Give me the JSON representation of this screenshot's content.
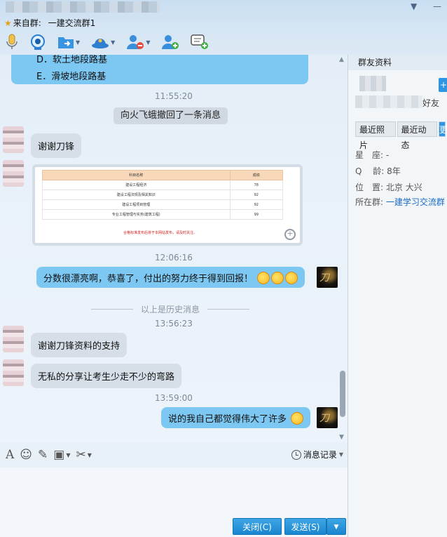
{
  "header": {
    "source_prefix": "来自群:",
    "group_name": "一建交流群1",
    "win_min": "▼",
    "win_close": "—"
  },
  "toolbar": [
    {
      "name": "voice",
      "has_caret": false
    },
    {
      "name": "video",
      "has_caret": false
    },
    {
      "name": "file",
      "has_caret": true
    },
    {
      "name": "app",
      "has_caret": true
    },
    {
      "name": "remove-member",
      "has_caret": false
    },
    {
      "name": "add-member",
      "has_caret": false
    },
    {
      "name": "new-message",
      "has_caret": false
    }
  ],
  "chat": {
    "top_options": [
      "D．软土地段路基",
      "E．滑坡地段路基"
    ],
    "messages": [
      {
        "time": "11:55:20"
      },
      {
        "recall": "向火飞蛾撤回了一条消息"
      },
      {
        "sender": "other",
        "text": "谢谢刀锋"
      },
      {
        "sender": "other",
        "type": "image"
      },
      {
        "time": "12:06:16"
      },
      {
        "sender": "me",
        "text": "分数很漂亮啊，恭喜了，付出的努力终于得到回报！"
      },
      {
        "divider": "以上是历史消息"
      },
      {
        "time": "13:56:23"
      },
      {
        "sender": "other",
        "text": "谢谢刀锋资料的支持"
      },
      {
        "sender": "other",
        "text": "无私的分享让考生少走不少的弯路"
      },
      {
        "time": "13:59:00"
      },
      {
        "sender": "me",
        "text": "说的我自己都觉得伟大了许多"
      }
    ],
    "score_table": {
      "headers": [
        "科目名称",
        "成绩"
      ],
      "rows": [
        [
          "建设工程经济",
          "78"
        ],
        [
          "建设工程法规及相关知识",
          "92"
        ],
        [
          "建设工程项目管理",
          "92"
        ],
        [
          "专业工程管理与实务(建筑工程)",
          "99"
        ]
      ],
      "note": "合格标准发布后将于本网站发布，请及时关注。"
    },
    "my_avatar_glyph": "刀"
  },
  "input_toolbar": {
    "history_label": "消息记录"
  },
  "buttons": {
    "close": "关闭(C)",
    "send": "发送(S)",
    "send_arrow": "▼"
  },
  "right_panel": {
    "title": "群友资料",
    "plus": "+",
    "friend_suffix": "好友",
    "tabs": [
      "最近照片",
      "最近动态",
      "更"
    ],
    "info": [
      {
        "label": "星　座:",
        "value": "-"
      },
      {
        "label": "Q　 龄:",
        "value": "8年"
      },
      {
        "label": "位　置:",
        "value": "北京 大兴"
      },
      {
        "label": "所在群:",
        "value": "一建学习交流群"
      }
    ]
  }
}
